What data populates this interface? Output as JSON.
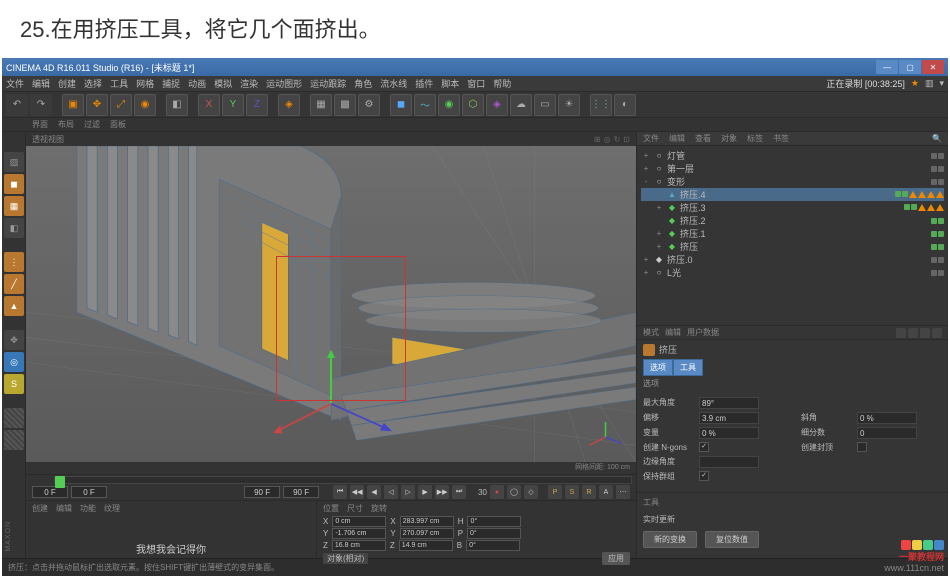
{
  "instruction": "25.在用挤压工具，将它几个面挤出。",
  "title": "CINEMA 4D R16.011 Studio (R16) - [未标题 1*]",
  "recording": "正在录制 [00:38:25]",
  "menu": [
    "文件",
    "编辑",
    "创建",
    "选择",
    "工具",
    "网格",
    "捕捉",
    "动画",
    "模拟",
    "渲染",
    "运动图形",
    "运动跟踪",
    "角色",
    "流水线",
    "插件",
    "脚本",
    "窗口",
    "帮助"
  ],
  "layout_tabs": [
    "界面",
    "布局",
    "过滤",
    "面板"
  ],
  "viewport_label": "透视视图",
  "viewport_footer": "网格间距: 100 cm",
  "objects": {
    "tabs": [
      "文件",
      "编辑",
      "查看",
      "对象",
      "标签",
      "书签"
    ],
    "tree": [
      {
        "depth": 0,
        "exp": "+",
        "name": "灯管",
        "icon": "○",
        "color": "#ccc",
        "dots": [
          "d",
          "d"
        ],
        "tris": 0
      },
      {
        "depth": 0,
        "exp": "+",
        "name": "第一层",
        "icon": "○",
        "color": "#ccc",
        "dots": [
          "d",
          "d"
        ],
        "tris": 0
      },
      {
        "depth": 0,
        "exp": "-",
        "name": "变形",
        "icon": "○",
        "color": "#ccc",
        "dots": [
          "d",
          "d"
        ],
        "tris": 0
      },
      {
        "depth": 1,
        "exp": "",
        "name": "挤压.4",
        "icon": "▲",
        "color": "#5ac",
        "dots": [
          "g",
          "g"
        ],
        "tris": 4,
        "selected": true
      },
      {
        "depth": 1,
        "exp": "+",
        "name": "挤压.3",
        "icon": "◆",
        "color": "#5c5",
        "dots": [
          "g",
          "g"
        ],
        "tris": 3
      },
      {
        "depth": 1,
        "exp": "",
        "name": "挤压.2",
        "icon": "◆",
        "color": "#5c5",
        "dots": [
          "g",
          "g"
        ],
        "tris": 0
      },
      {
        "depth": 1,
        "exp": "+",
        "name": "挤压.1",
        "icon": "◆",
        "color": "#5c5",
        "dots": [
          "g",
          "g"
        ],
        "tris": 0
      },
      {
        "depth": 1,
        "exp": "+",
        "name": "挤压",
        "icon": "◆",
        "color": "#5c5",
        "dots": [
          "g",
          "g"
        ],
        "tris": 0
      },
      {
        "depth": 0,
        "exp": "+",
        "name": "挤压.0",
        "icon": "◆",
        "color": "#ccc",
        "dots": [
          "d",
          "d"
        ],
        "tris": 0
      },
      {
        "depth": 0,
        "exp": "+",
        "name": "L光",
        "icon": "○",
        "color": "#ccc",
        "dots": [
          "d",
          "d"
        ],
        "tris": 0
      }
    ]
  },
  "attributes": {
    "tabs": [
      "模式",
      "编辑",
      "用户数据"
    ],
    "tool_name": "挤压",
    "subtabs": [
      "选项",
      "工具"
    ],
    "section": "选项",
    "fields": {
      "max_angle_label": "最大角度",
      "max_angle": "89°",
      "offset_label": "偏移",
      "offset": "3.9 cm",
      "var_label": "变量",
      "var": "0 %",
      "bevel_label": "斜角",
      "bevel": "0 %",
      "subdiv_label": "细分数",
      "subdiv": "0",
      "ngons_label": "创建 N-gons",
      "ngons": true,
      "cap_label": "创建封顶",
      "cap": false,
      "edge_angle_label": "边缘角度",
      "edge_angle": "",
      "preserve_label": "保持群组",
      "preserve": true
    },
    "tools_section": "工具",
    "realtime_label": "实时更新",
    "btn_apply": "新的变换",
    "btn_reset": "复位数值"
  },
  "timeline": {
    "start": "0 F",
    "current": "0 F",
    "end": "90 F",
    "maxend": "90 F",
    "fps": "30"
  },
  "coords": {
    "tabs": [
      "位置",
      "尺寸",
      "旋转"
    ],
    "rows": [
      {
        "l": "X",
        "p": "0 cm",
        "s": "283.997 cm",
        "r": "0°"
      },
      {
        "l": "Y",
        "p": "-1.706 cm",
        "s": "270.097 cm",
        "r": "0°"
      },
      {
        "l": "Z",
        "p": "16.8 cm",
        "s": "14.9 cm",
        "r": "0°"
      }
    ],
    "mode": "对象(相对)",
    "apply": "应用"
  },
  "mat_tabs": [
    "创建",
    "编辑",
    "功能",
    "纹理"
  ],
  "subtitle": "我想我会记得你",
  "statusbar": "挤压：点击并拖动鼠标扩出选取元素。按住SHIFT键扩出薄壁式的变异集面。",
  "watermark": {
    "brand": "一聚教程网",
    "url": "www.111cn.net"
  }
}
